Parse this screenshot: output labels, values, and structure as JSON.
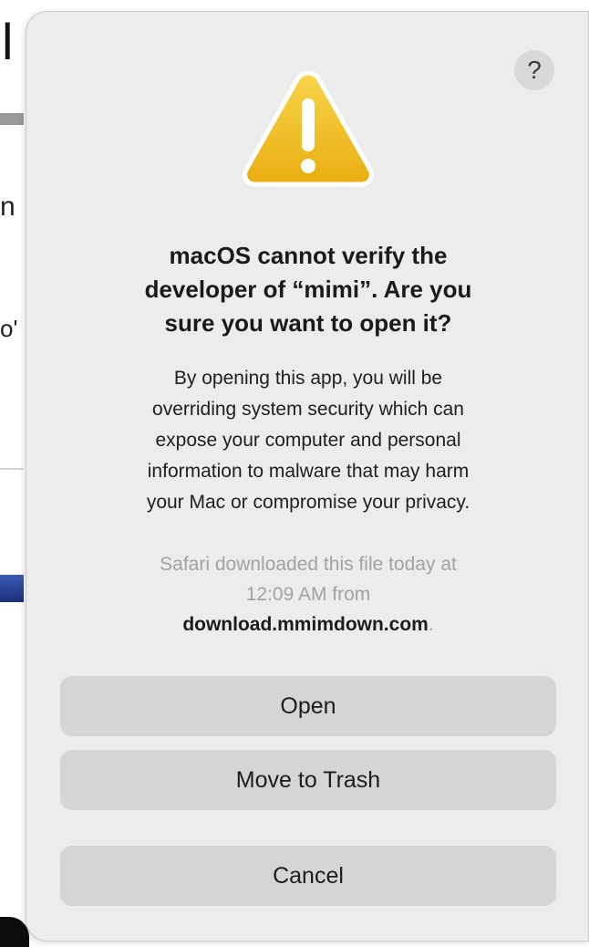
{
  "background": {
    "title_char": "l",
    "char_n": "n",
    "char_o": "o'"
  },
  "dialog": {
    "help_label": "?",
    "icon": "warning-triangle-icon",
    "headline": "macOS cannot verify the\ndeveloper of “mimi”. Are you\nsure you want to open it?",
    "body": "By opening this app, you will be\noverriding system security which can\nexpose your computer and personal\ninformation to malware that may harm\nyour Mac or compromise your privacy.",
    "source_line1": "Safari downloaded this file today at",
    "source_line2": "12:09 AM from",
    "source_domain": "download.mmimdown.com",
    "source_period": ".",
    "buttons": {
      "open": "Open",
      "move_to_trash": "Move to Trash",
      "cancel": "Cancel"
    }
  },
  "colors": {
    "dialog_bg": "#ececec",
    "button_bg": "#d5d5d5",
    "warning_yellow": "#f2c21a",
    "muted_text": "#a2a2a2"
  }
}
